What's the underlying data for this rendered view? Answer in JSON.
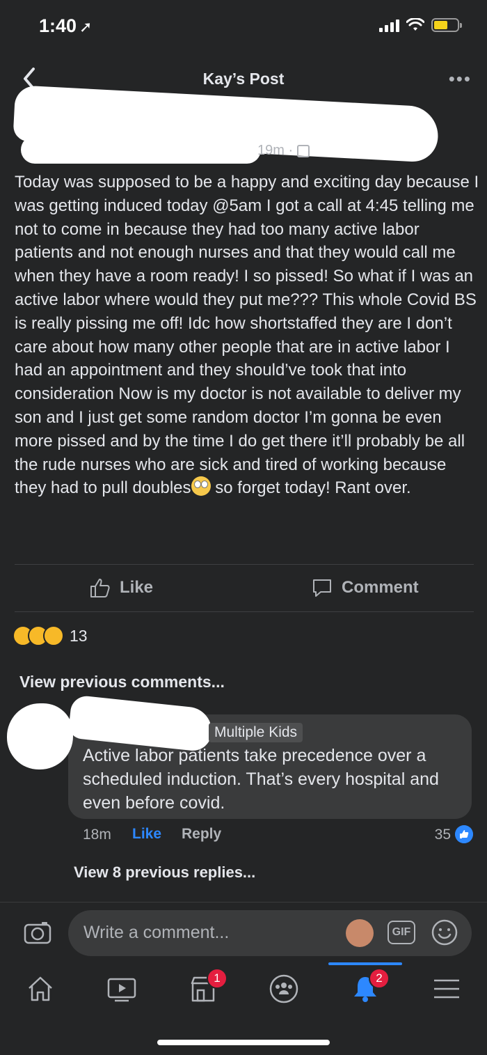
{
  "status": {
    "time": "1:40"
  },
  "nav": {
    "title": "Kay’s Post"
  },
  "post": {
    "meta_time": "19m ·",
    "body": "Today was supposed to be a happy and exciting day because I was getting induced today @5am I got a call at 4:45 telling me not to come in because they had too many active labor patients and not enough nurses and that they would call me when they have a room ready! I so pissed! So what if I was an active labor where would they put me??? This whole Covid BS is really pissing me off! Idc how shortstaffed they are I don’t care about how many other people that are in active labor I had an appointment and they should’ve took that into consideration Now is my doctor is not available to deliver my son and I just get some random doctor I’m gonna be even more pissed and by the time I do get there it’ll probably be all the rude nurses who are sick and tired of working because they had to pull doubles",
    "body_end": " so forget today! Rant over."
  },
  "actions": {
    "like": "Like",
    "comment": "Comment"
  },
  "reactions": {
    "count": "13"
  },
  "comments": {
    "view_previous": "View previous comments...",
    "badge": "Multiple Kids",
    "text": "Active labor patients take precedence over a scheduled induction. That’s every hospital and even before covid.",
    "time": "18m",
    "like": "Like",
    "reply": "Reply",
    "like_count": "35",
    "view_replies": "View 8 previous replies..."
  },
  "composer": {
    "placeholder": "Write a comment...",
    "gif": "GIF"
  },
  "tabs": {
    "marketplace_badge": "1",
    "notifications_badge": "2"
  }
}
